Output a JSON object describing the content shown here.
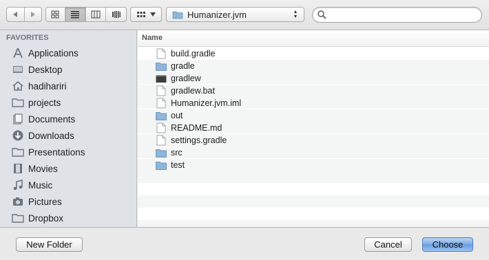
{
  "toolbar": {
    "nav": [
      {
        "icon": "back-arrow-icon"
      },
      {
        "icon": "forward-arrow-icon"
      }
    ],
    "view_modes": [
      {
        "icon": "icon-view-icon",
        "active": false
      },
      {
        "icon": "list-view-icon",
        "active": true
      },
      {
        "icon": "column-view-icon",
        "active": false
      },
      {
        "icon": "coverflow-view-icon",
        "active": false
      }
    ],
    "arrange": {
      "icon": "arrange-grid-icon",
      "dropdown_icon": "triangle-down-icon"
    },
    "path": {
      "label": "Humanizer.jvm",
      "icon": "folder-icon"
    },
    "search": {
      "placeholder": "",
      "value": "",
      "icon": "search-icon"
    }
  },
  "sidebar": {
    "header": "FAVORITES",
    "items": [
      {
        "label": "Applications",
        "icon": "applications-icon"
      },
      {
        "label": "Desktop",
        "icon": "desktop-icon"
      },
      {
        "label": "hadihariri",
        "icon": "home-icon"
      },
      {
        "label": "projects",
        "icon": "folder-icon"
      },
      {
        "label": "Documents",
        "icon": "documents-icon"
      },
      {
        "label": "Downloads",
        "icon": "downloads-icon"
      },
      {
        "label": "Presentations",
        "icon": "folder-icon"
      },
      {
        "label": "Movies",
        "icon": "movies-icon"
      },
      {
        "label": "Music",
        "icon": "music-icon"
      },
      {
        "label": "Pictures",
        "icon": "pictures-icon"
      },
      {
        "label": "Dropbox",
        "icon": "folder-icon"
      }
    ]
  },
  "file_list": {
    "column_header": "Name",
    "rows": [
      {
        "name": "build.gradle",
        "icon": "document-icon"
      },
      {
        "name": "gradle",
        "icon": "folder-icon"
      },
      {
        "name": "gradlew",
        "icon": "executable-icon"
      },
      {
        "name": "gradlew.bat",
        "icon": "document-icon"
      },
      {
        "name": "Humanizer.jvm.iml",
        "icon": "document-icon"
      },
      {
        "name": "out",
        "icon": "folder-icon"
      },
      {
        "name": "README.md",
        "icon": "document-icon"
      },
      {
        "name": "settings.gradle",
        "icon": "document-icon"
      },
      {
        "name": "src",
        "icon": "folder-icon"
      },
      {
        "name": "test",
        "icon": "folder-icon"
      }
    ]
  },
  "buttons": {
    "new_folder": "New Folder",
    "cancel": "Cancel",
    "choose": "Choose"
  },
  "colors": {
    "sidebar_bg": "#dfe3e8",
    "folder_blue": "#8fb5d9",
    "default_button": "#6fa1e2"
  }
}
